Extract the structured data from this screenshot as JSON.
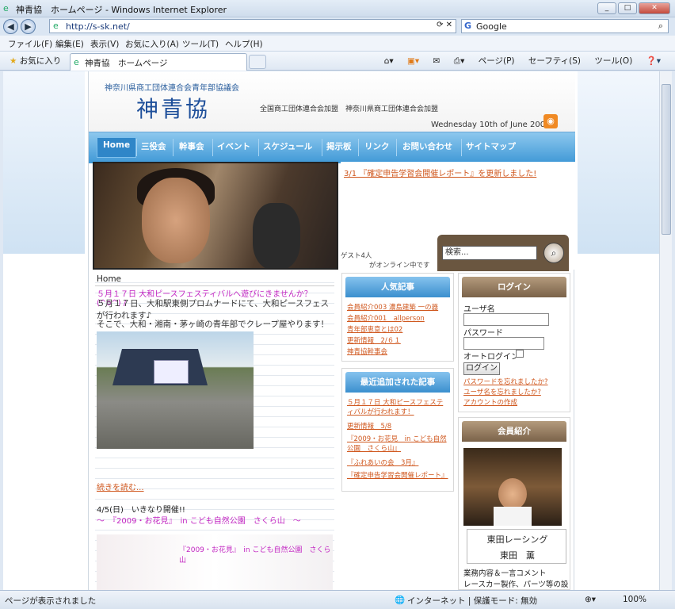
{
  "window": {
    "title": "神青協　ホームページ - Windows Internet Explorer"
  },
  "address": {
    "url": "http://s-sk.net/",
    "search_placeholder": "Google"
  },
  "menu": {
    "items": [
      "ファイル(F)",
      "編集(E)",
      "表示(V)",
      "お気に入り(A)",
      "ツール(T)",
      "ヘルプ(H)"
    ]
  },
  "favbar": {
    "favorites": "お気に入り",
    "tab_title": "神青協　ホームページ"
  },
  "commands": {
    "page": "ページ(P)",
    "safety": "セーフティ(S)",
    "tools": "ツール(O)"
  },
  "site": {
    "association": "神奈川県商工団体連合会青年部協議会",
    "logo": "神青協",
    "tagline": "全国商工団体連合会加盟　神奈川県商工団体連合会加盟",
    "date": "Wednesday 10th of June 2009",
    "nav": [
      "Home",
      "三役会",
      "幹事会",
      "イベント",
      "スケジュール",
      "掲示板",
      "リンク",
      "お問い合わせ",
      "サイトマップ"
    ],
    "news": "3/1 『確定申告学習会開催レポート』を更新しました!",
    "guest": "ゲスト4人",
    "online": "がオンライン中です",
    "search_placeholder": "検索...",
    "breadcrumb": "Home",
    "article1": {
      "title": "５月１７日 大和ピースフェスティバルへ遊びにきませんか？(^o^) /",
      "p1": "５月１７日、大和駅東側プロムナードにて、大和ピースフェスが行われます♪",
      "p2": "そこで、大和・湘南・茅ヶ崎の青年部でクレープ屋やります！",
      "more": "続きを読む..."
    },
    "article2": {
      "date": "4/5(日)　いきなり開催!!",
      "title": "～　『2009・お花見』　in こども自然公園　さくら山　～",
      "caption": "『2009・お花見』　in こども自然公園　さくら山"
    },
    "popular": {
      "title": "人気記事",
      "items": [
        "会員紹介003 濃島建築 一の器",
        "会員紹介001　allperson",
        "青年部恵意とは02",
        "更新情報　2/６１",
        "神青協幹事会"
      ]
    },
    "recent": {
      "title": "最近追加された記事",
      "items": [
        "５月１７日 大和ピースフェスティバルが行われます！",
        "更新情報　5/8",
        "『2009・お花見　in こども自然公園　さくら山』",
        "『ふれあいの会　3月』",
        "『確定申告学習会開催レポート』"
      ]
    },
    "login": {
      "title": "ログイン",
      "user": "ユーザ名",
      "pass": "パスワード",
      "auto": "オートログイン",
      "button": "ログイン",
      "forgot_pass": "パスワードを忘れましたか?",
      "forgot_user": "ユーザ名を忘れましたか?",
      "create": "アカウントの作成"
    },
    "member": {
      "title": "会員紹介",
      "company": "東田レーシング",
      "name": "東田　薫",
      "desc1": "業務内容＆一言コメント",
      "desc2": "レースカー製作、パーツ等の設"
    }
  },
  "status": {
    "left": "ページが表示されました",
    "zone": "インターネット | 保護モード: 無効",
    "zoom": "100%"
  }
}
